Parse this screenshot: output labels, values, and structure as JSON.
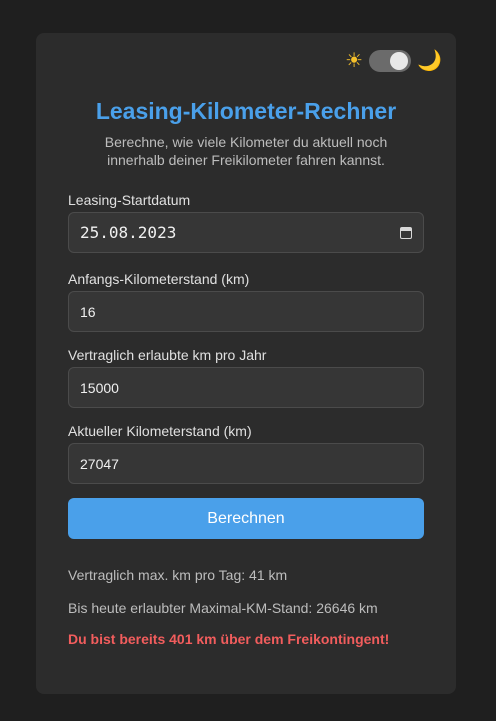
{
  "theme_toggle": {
    "light_icon": "sun-icon",
    "dark_icon": "moon-icon",
    "sun_glyph": "☀",
    "moon_glyph": "🌙",
    "state": "dark"
  },
  "title": "Leasing-Kilometer-Rechner",
  "subtitle": "Berechne, wie viele Kilometer du aktuell noch innerhalb deiner Freikilometer fahren kannst.",
  "fields": {
    "start_date": {
      "label": "Leasing-Startdatum",
      "value": "25.08.2023",
      "icon": "calendar-icon"
    },
    "start_km": {
      "label": "Anfangs-Kilometerstand (km)",
      "value": "16"
    },
    "km_per_year": {
      "label": "Vertraglich erlaubte km pro Jahr",
      "value": "15000"
    },
    "current_km": {
      "label": "Aktueller Kilometerstand (km)",
      "value": "27047"
    }
  },
  "button": {
    "label": "Berechnen"
  },
  "results": {
    "per_day": "Vertraglich max. km pro Tag: 41 km",
    "allowed_today": "Bis heute erlaubter Maximal-KM-Stand: 26646 km",
    "warning_prefix": "Du bist bereits ",
    "warning_value": "401",
    "warning_suffix": " km über dem Freikontingent!"
  },
  "colors": {
    "accent": "#4aa0ea",
    "warning": "#f25d5d",
    "background": "#1f1f1f",
    "card": "#2c2c2c"
  }
}
